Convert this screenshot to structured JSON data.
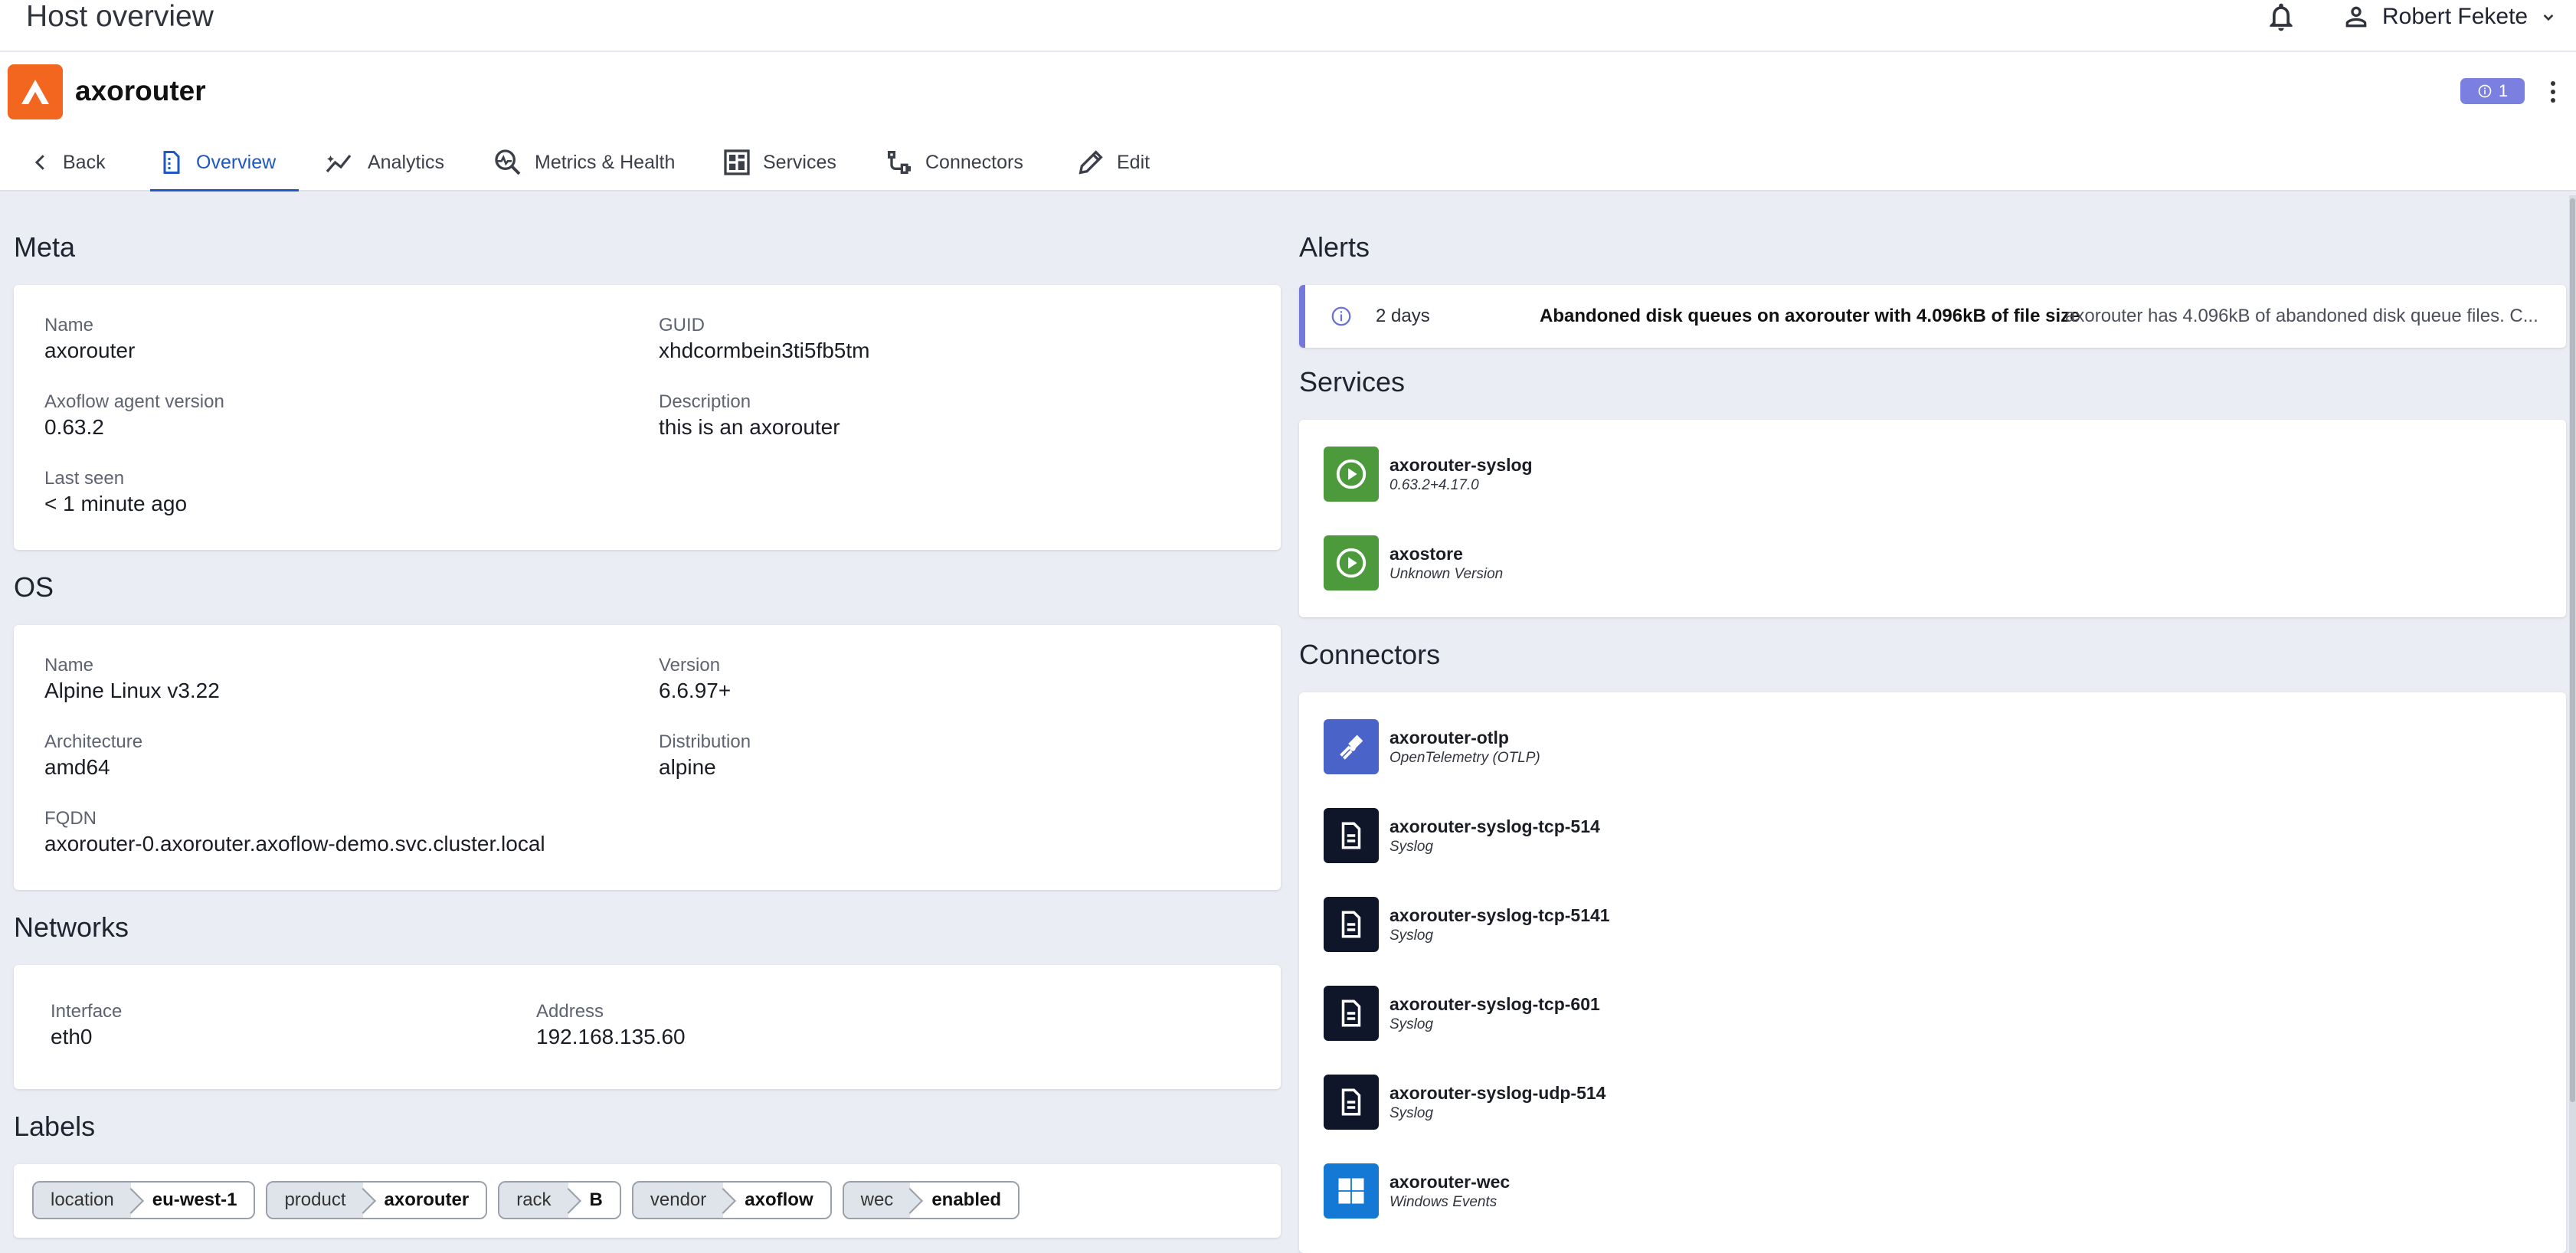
{
  "topbar": {
    "page_title": "Host overview",
    "user_name": "Robert Fekete"
  },
  "host": {
    "name": "axorouter",
    "alert_count": "1"
  },
  "tabs": [
    {
      "label": "Back",
      "icon": "chevron-left-icon"
    },
    {
      "label": "Overview",
      "icon": "document-icon",
      "active": true
    },
    {
      "label": "Analytics",
      "icon": "analytics-icon"
    },
    {
      "label": "Metrics & Health",
      "icon": "metrics-icon"
    },
    {
      "label": "Services",
      "icon": "grid-icon"
    },
    {
      "label": "Connectors",
      "icon": "connector-icon"
    },
    {
      "label": "Edit",
      "icon": "pencil-icon"
    }
  ],
  "meta": {
    "title": "Meta",
    "name_label": "Name",
    "name": "axorouter",
    "guid_label": "GUID",
    "guid": "xhdcormbein3ti5fb5tm",
    "agent_label": "Axoflow agent version",
    "agent": "0.63.2",
    "desc_label": "Description",
    "desc": "this is an axorouter",
    "seen_label": "Last seen",
    "seen": "< 1 minute ago"
  },
  "os": {
    "title": "OS",
    "name_label": "Name",
    "name": "Alpine Linux v3.22",
    "version_label": "Version",
    "version": "6.6.97+",
    "arch_label": "Architecture",
    "arch": "amd64",
    "dist_label": "Distribution",
    "dist": "alpine",
    "fqdn_label": "FQDN",
    "fqdn": "axorouter-0.axorouter.axoflow-demo.svc.cluster.local"
  },
  "networks": {
    "title": "Networks",
    "iface_label": "Interface",
    "iface": "eth0",
    "addr_label": "Address",
    "addr": "192.168.135.60"
  },
  "labels": {
    "title": "Labels",
    "items": [
      {
        "key": "location",
        "value": "eu-west-1"
      },
      {
        "key": "product",
        "value": "axorouter"
      },
      {
        "key": "rack",
        "value": "B"
      },
      {
        "key": "vendor",
        "value": "axoflow"
      },
      {
        "key": "wec",
        "value": "enabled"
      }
    ]
  },
  "alerts": {
    "title": "Alerts",
    "items": [
      {
        "age": "2 days",
        "summary": "Abandoned disk queues on axorouter with 4.096kB of file size",
        "detail": "axorouter has 4.096kB of abandoned disk queue files. C..."
      }
    ]
  },
  "services": {
    "title": "Services",
    "items": [
      {
        "name": "axorouter-syslog",
        "version": "0.63.2+4.17.0",
        "icon": "play-circle-icon",
        "color": "#4c9a3b"
      },
      {
        "name": "axostore",
        "version": "Unknown Version",
        "icon": "play-circle-icon",
        "color": "#4c9a3b"
      }
    ]
  },
  "connectors": {
    "title": "Connectors",
    "items": [
      {
        "name": "axorouter-otlp",
        "type": "OpenTelemetry (OTLP)",
        "icon": "telescope-icon",
        "color": "#4a63c9"
      },
      {
        "name": "axorouter-syslog-tcp-514",
        "type": "Syslog",
        "icon": "file-icon",
        "color": "#0f1629"
      },
      {
        "name": "axorouter-syslog-tcp-5141",
        "type": "Syslog",
        "icon": "file-icon",
        "color": "#0f1629"
      },
      {
        "name": "axorouter-syslog-tcp-601",
        "type": "Syslog",
        "icon": "file-icon",
        "color": "#0f1629"
      },
      {
        "name": "axorouter-syslog-udp-514",
        "type": "Syslog",
        "icon": "file-icon",
        "color": "#0f1629"
      },
      {
        "name": "axorouter-wec",
        "type": "Windows Events",
        "icon": "windows-icon",
        "color": "#1479d4"
      }
    ]
  },
  "colors": {
    "brand": "#f2661f",
    "accent": "#1f57c3",
    "alert": "#7b80e0"
  }
}
